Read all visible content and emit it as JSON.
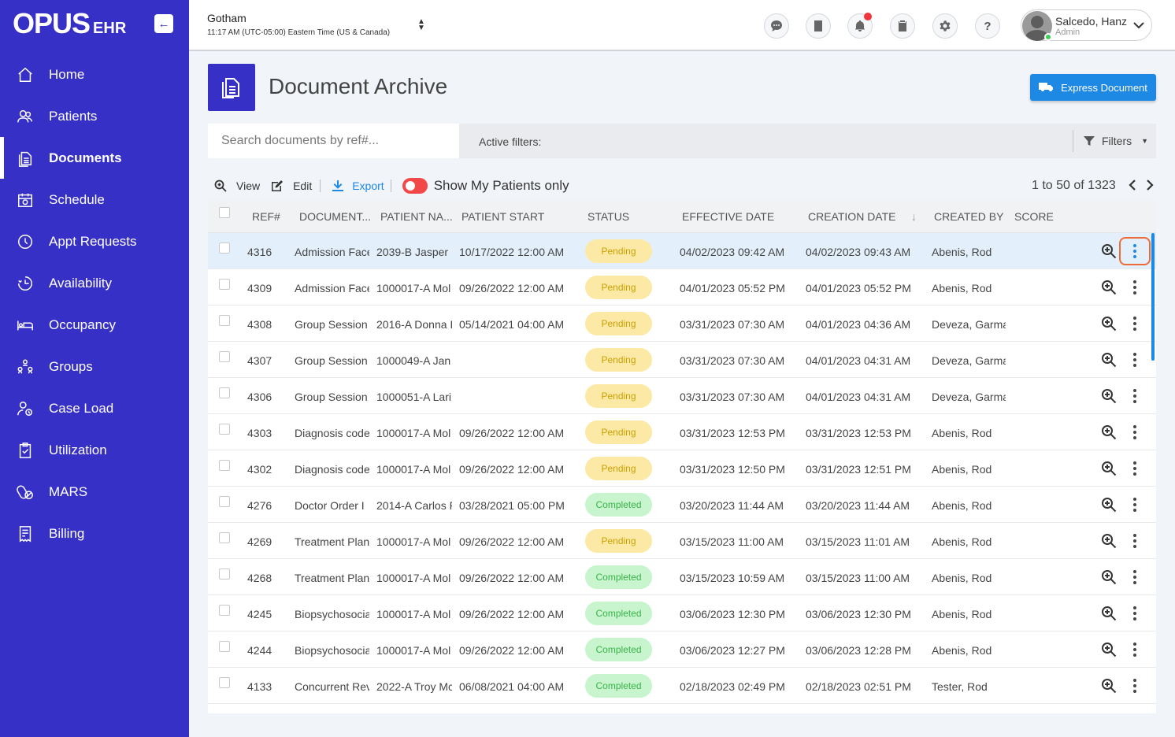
{
  "app": {
    "logo_main": "OPUS",
    "logo_sub": "EHR"
  },
  "sidebar": {
    "items": [
      {
        "label": "Home",
        "icon": "home-icon"
      },
      {
        "label": "Patients",
        "icon": "patients-icon"
      },
      {
        "label": "Documents",
        "icon": "documents-icon",
        "active": true
      },
      {
        "label": "Schedule",
        "icon": "calendar-icon"
      },
      {
        "label": "Appt Requests",
        "icon": "clock-icon"
      },
      {
        "label": "Availability",
        "icon": "availability-icon"
      },
      {
        "label": "Occupancy",
        "icon": "bed-icon"
      },
      {
        "label": "Groups",
        "icon": "groups-icon"
      },
      {
        "label": "Case Load",
        "icon": "case-load-icon"
      },
      {
        "label": "Utilization",
        "icon": "clipboard-check-icon"
      },
      {
        "label": "MARS",
        "icon": "pills-icon"
      },
      {
        "label": "Billing",
        "icon": "billing-icon"
      }
    ]
  },
  "header": {
    "location": "Gotham",
    "time": "11:17 AM (UTC-05:00) Eastern Time (US & Canada)",
    "user_name": "Salcedo, Hanz",
    "user_role": "Admin"
  },
  "page": {
    "title": "Document Archive",
    "express_button": "Express Document",
    "search_placeholder": "Search documents by ref#...",
    "active_filters": "Active filters:",
    "filters_button": "Filters"
  },
  "toolbar": {
    "view": "View",
    "edit": "Edit",
    "export": "Export",
    "toggle_label": "Show My Patients only",
    "pager": "1 to 50 of 1323"
  },
  "table": {
    "columns": [
      "REF#",
      "DOCUMENT...",
      "PATIENT NA...",
      "PATIENT START",
      "STATUS",
      "EFFECTIVE DATE",
      "CREATION DATE",
      "CREATED BY",
      "SCORE"
    ],
    "rows": [
      {
        "ref": "4316",
        "doc": "Admission Face",
        "patient": "2039-B Jasper",
        "start": "10/17/2022 12:00 AM",
        "status": "Pending",
        "effective": "04/02/2023 09:42 AM",
        "created": "04/02/2023 09:43 AM",
        "by": "Abenis, Rod"
      },
      {
        "ref": "4309",
        "doc": "Admission Face",
        "patient": "1000017-A Mol",
        "start": "09/26/2022 12:00 AM",
        "status": "Pending",
        "effective": "04/01/2023 05:52 PM",
        "created": "04/01/2023 05:52 PM",
        "by": "Abenis, Rod"
      },
      {
        "ref": "4308",
        "doc": "Group Session",
        "patient": "2016-A Donna I",
        "start": "05/14/2021 04:00 AM",
        "status": "Pending",
        "effective": "03/31/2023 07:30 AM",
        "created": "04/01/2023 04:36 AM",
        "by": "Deveza, Garma"
      },
      {
        "ref": "4307",
        "doc": "Group Session",
        "patient": "1000049-A Jan",
        "start": "",
        "status": "Pending",
        "effective": "03/31/2023 07:30 AM",
        "created": "04/01/2023 04:31 AM",
        "by": "Deveza, Garma"
      },
      {
        "ref": "4306",
        "doc": "Group Session",
        "patient": "1000051-A Lari",
        "start": "",
        "status": "Pending",
        "effective": "03/31/2023 07:30 AM",
        "created": "04/01/2023 04:31 AM",
        "by": "Deveza, Garma"
      },
      {
        "ref": "4303",
        "doc": "Diagnosis code",
        "patient": "1000017-A Mol",
        "start": "09/26/2022 12:00 AM",
        "status": "Pending",
        "effective": "03/31/2023 12:53 PM",
        "created": "03/31/2023 12:53 PM",
        "by": "Abenis, Rod"
      },
      {
        "ref": "4302",
        "doc": "Diagnosis code",
        "patient": "1000017-A Mol",
        "start": "09/26/2022 12:00 AM",
        "status": "Pending",
        "effective": "03/31/2023 12:50 PM",
        "created": "03/31/2023 12:51 PM",
        "by": "Abenis, Rod"
      },
      {
        "ref": "4276",
        "doc": "Doctor Order I",
        "patient": "2014-A Carlos F",
        "start": "03/28/2021 05:00 PM",
        "status": "Completed",
        "effective": "03/20/2023 11:44 AM",
        "created": "03/20/2023 11:44 AM",
        "by": "Abenis, Rod"
      },
      {
        "ref": "4269",
        "doc": "Treatment Plan",
        "patient": "1000017-A Mol",
        "start": "09/26/2022 12:00 AM",
        "status": "Pending",
        "effective": "03/15/2023 11:00 AM",
        "created": "03/15/2023 11:01 AM",
        "by": "Abenis, Rod"
      },
      {
        "ref": "4268",
        "doc": "Treatment Plan",
        "patient": "1000017-A Mol",
        "start": "09/26/2022 12:00 AM",
        "status": "Completed",
        "effective": "03/15/2023 10:59 AM",
        "created": "03/15/2023 11:00 AM",
        "by": "Abenis, Rod"
      },
      {
        "ref": "4245",
        "doc": "Biopsychosocia",
        "patient": "1000017-A Mol",
        "start": "09/26/2022 12:00 AM",
        "status": "Completed",
        "effective": "03/06/2023 12:30 PM",
        "created": "03/06/2023 12:30 PM",
        "by": "Abenis, Rod"
      },
      {
        "ref": "4244",
        "doc": "Biopsychosocia",
        "patient": "1000017-A Mol",
        "start": "09/26/2022 12:00 AM",
        "status": "Completed",
        "effective": "03/06/2023 12:27 PM",
        "created": "03/06/2023 12:28 PM",
        "by": "Abenis, Rod"
      },
      {
        "ref": "4133",
        "doc": "Concurrent Rev",
        "patient": "2022-A Troy Mc",
        "start": "06/08/2021 04:00 AM",
        "status": "Completed",
        "effective": "02/18/2023 02:49 PM",
        "created": "02/18/2023 02:51 PM",
        "by": "Tester, Rod"
      }
    ]
  }
}
